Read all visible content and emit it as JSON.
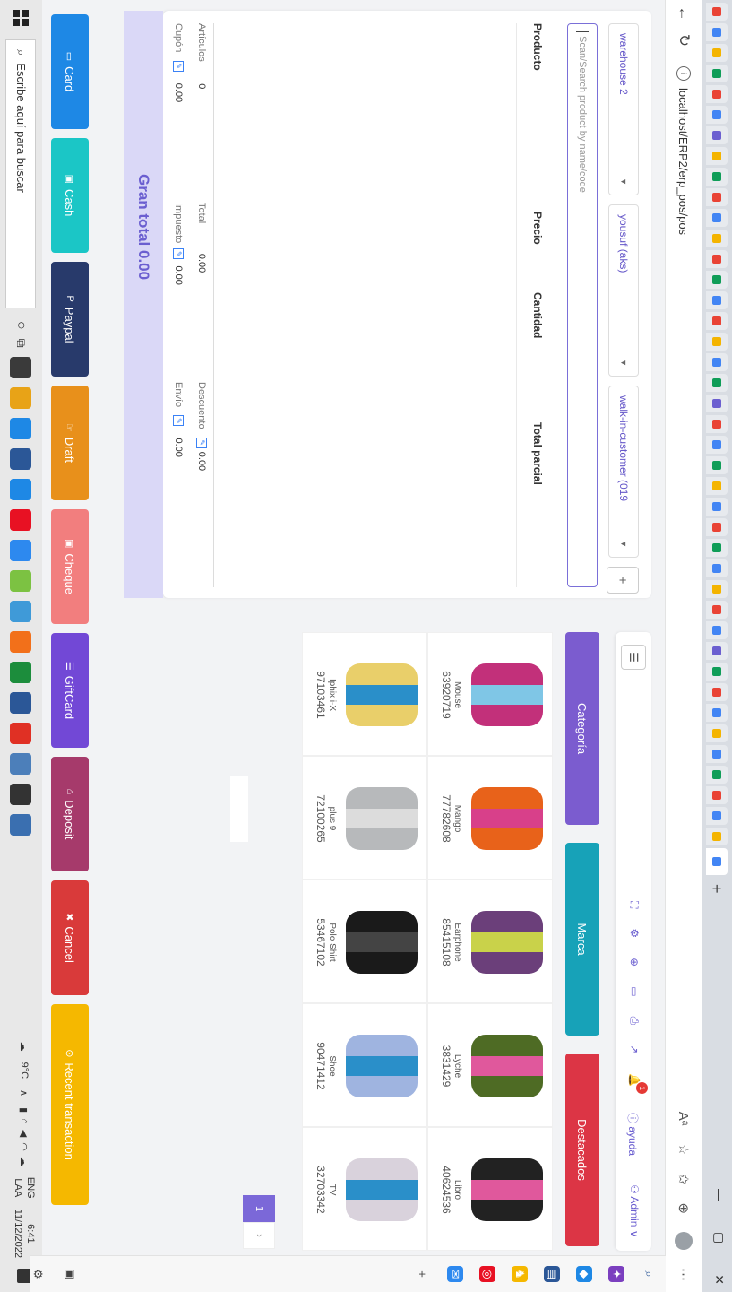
{
  "browser": {
    "url": "localhost/ERP2/erp_pos/pos",
    "tab_new": "+",
    "win_minimize": "—",
    "win_maximize": "▢",
    "win_close": "✕",
    "tab_favicon_colors": [
      "#e94335",
      "#4285f4",
      "#f4b400",
      "#0f9d58",
      "#e94335",
      "#4285f4",
      "#6b5fd0",
      "#f4b400",
      "#0f9d58",
      "#e94335",
      "#4285f4",
      "#f4b400",
      "#e94335",
      "#0f9d58",
      "#4285f4",
      "#e94335",
      "#f4b400",
      "#4285f4",
      "#0f9d58",
      "#6b5fd0",
      "#e94335",
      "#4285f4",
      "#0f9d58",
      "#f4b400",
      "#4285f4",
      "#e94335",
      "#0f9d58",
      "#4285f4",
      "#f4b400",
      "#e94335",
      "#4285f4",
      "#6b5fd0",
      "#0f9d58",
      "#e94335",
      "#4285f4",
      "#f4b400",
      "#4285f4",
      "#0f9d58",
      "#e94335",
      "#4285f4",
      "#f4b400",
      "#4285f4"
    ]
  },
  "pos": {
    "warehouse": "warehouse 2",
    "user": "yousuf (aks)",
    "customer": "walk-in-customer (019",
    "add_label": "+",
    "search_placeholder": "Scan/Search product by name/code",
    "columns": [
      "Producto",
      "Precio",
      "Cantidad",
      "Total parcial"
    ],
    "totals": {
      "articulos_label": "Artículos",
      "articulos_value": "0",
      "total_label": "Total",
      "total_value": "0.00",
      "descuento_label": "Descuento",
      "descuento_value": "0.00",
      "cupon_label": "Cupón",
      "cupon_value": "0.00",
      "impuesto_label": "Impuesto",
      "impuesto_value": "0.00",
      "envio_label": "Envío",
      "envio_value": "0.00"
    },
    "grand_total": "Gran total 0.00"
  },
  "topbar": {
    "menu_icon": "☰",
    "icons": [
      "⛶",
      "⚙",
      "⊕",
      "▭",
      "⎙",
      "↗",
      "🔔"
    ],
    "notification_count": "1",
    "help": "ⓘ ayuda",
    "admin": "⚇ Admin ∨"
  },
  "filters": [
    {
      "label": "Categoría",
      "color": "#7b5ccf"
    },
    {
      "label": "Marca",
      "color": "#17a2b8"
    },
    {
      "label": "Destacados",
      "color": "#dc3545"
    }
  ],
  "products": [
    {
      "name": "Mouse",
      "code": "63920719",
      "c1": "#c2307a",
      "c2": "#7fc6e6"
    },
    {
      "name": "Mango",
      "code": "77782608",
      "c1": "#e8621a",
      "c2": "#d8408a"
    },
    {
      "name": "Earphone",
      "code": "85415108",
      "c1": "#6b3f7a",
      "c2": "#c9d24a"
    },
    {
      "name": "Lyche",
      "code": "3831429",
      "c1": "#4e6b24",
      "c2": "#e0589c"
    },
    {
      "name": "Libro",
      "code": "40624536",
      "c1": "#222222",
      "c2": "#e0589c"
    },
    {
      "name": "Iphix i-X",
      "code": "97103461",
      "c1": "#e9cf6a",
      "c2": "#2a8fc9"
    },
    {
      "name": "plus 9",
      "code": "72100265",
      "c1": "#b7b9bb",
      "c2": "#dcdcdc"
    },
    {
      "name": "Polo Shirt",
      "code": "53467102",
      "c1": "#1a1a1a",
      "c2": "#444444"
    },
    {
      "name": "Shoe",
      "code": "90471412",
      "c1": "#9fb4e0",
      "c2": "#2a8fc9"
    },
    {
      "name": "TV",
      "code": "32703342",
      "c1": "#d9d2dc",
      "c2": "#2a8fc9"
    }
  ],
  "pager": {
    "current": "1",
    "next": "›"
  },
  "payments": [
    {
      "icon": "▭",
      "label": "Card",
      "color": "#1e88e5"
    },
    {
      "icon": "▣",
      "label": "Cash",
      "color": "#1bc6c6"
    },
    {
      "icon": "P",
      "label": "Paypal",
      "color": "#283a6b"
    },
    {
      "icon": "☞",
      "label": "Draft",
      "color": "#e8901b"
    },
    {
      "icon": "▣",
      "label": "Cheque",
      "color": "#f27e7e"
    },
    {
      "icon": "☰",
      "label": "GiftCard",
      "color": "#7248d6"
    },
    {
      "icon": "⌂",
      "label": "Deposit",
      "color": "#a63a6b"
    },
    {
      "icon": "✖",
      "label": "Cancel",
      "color": "#d93a3a"
    },
    {
      "icon": "⊙",
      "label": "Recent transaction",
      "color": "#f5b800"
    }
  ],
  "taskbar": {
    "search_text": "Escribe aquí para buscar",
    "apps": [
      "#3a3a3a",
      "#e8a317",
      "#1e88e5",
      "#2b5797",
      "#1e88e5",
      "#e81123",
      "#2d89ef",
      "#7cc242",
      "#3f9ad8",
      "#f2701a",
      "#1c8d3c",
      "#2b5797",
      "#e03024",
      "#4c7fba",
      "#333333",
      "#3a6fb0"
    ],
    "weather": "9°C",
    "lang_top": "ENG",
    "lang_bottom": "LAA",
    "time": "6:41",
    "date": "11/12/2022"
  }
}
